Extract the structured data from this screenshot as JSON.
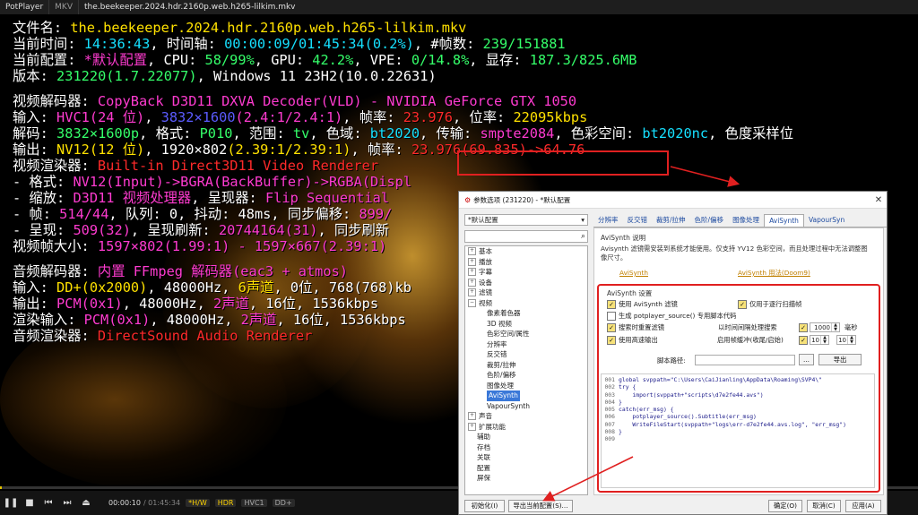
{
  "topbar": {
    "brand": "PotPlayer",
    "tabs": [
      "MKV",
      "the.beekeeper.2024.hdr.2160p.web.h265-lilkim.mkv"
    ]
  },
  "osd": {
    "file": {
      "label": "文件名:",
      "value": "the.beekeeper.2024.hdr.2160p.web.h265-lilkim.mkv"
    },
    "time": {
      "label": "当前时间:",
      "clock": "14:36:43",
      "timeline_label": "时间轴:",
      "timeline": "00:00:09/01:45:34",
      "pct": "(0.2%)",
      "frames_label": "#帧数:",
      "frames": "239/151881"
    },
    "config": {
      "label": "当前配置:",
      "profile": "*默认配置",
      "cpu_label": "CPU:",
      "cpu": "58/99%",
      "gpu_label": "GPU:",
      "gpu": "42.2%",
      "vpe_label": "VPE:",
      "vpe": "0/14.8%",
      "vram_label": "显存:",
      "vram": "187.3/825.6MB"
    },
    "version": {
      "label": "版本:",
      "value": "231220(1.7.22077)",
      "os": "Windows 11 23H2(10.0.22631)"
    },
    "vdec": {
      "label": "视频解码器:",
      "value": "CopyBack D3D11 DXVA Decoder(VLD) - NVIDIA GeForce GTX 1050"
    },
    "vin": {
      "label": "输入:",
      "codec": "HVC1(24 位)",
      "res": "3832×1600",
      "ar": "(2.4:1/2.4:1)",
      "fps_label": "帧率:",
      "fps": "23.976",
      "br_label": "位率:",
      "br": "22095kbps"
    },
    "vdecode": {
      "label": "解码:",
      "res": "3832×1600p",
      "fmt_label": "格式:",
      "fmt": "P010",
      "range_label": "范围:",
      "range": "tv",
      "prim_label": "色域:",
      "prim": "bt2020",
      "trc_label": "传输:",
      "trc": "smpte2084",
      "cs_label": "色彩空间:",
      "cs": "bt2020nc",
      "tail": "色度采样位"
    },
    "vout": {
      "label": "输出:",
      "fmt": "NV12(12 位)",
      "res": "1920×802",
      "ar": "(2.39:1/2.39:1)",
      "fps_label": "帧率:",
      "fps": "23.976(69.835)",
      "arrow": "->",
      "fps_out": "64.76"
    },
    "vren": {
      "label": "视频渲染器:",
      "value": "Built-in Direct3D11 Video Renderer"
    },
    "vren_fmt": {
      "label": " - 格式:",
      "value": "NV12(Input)->BGRA(BackBuffer)->RGBA(Displ"
    },
    "vren_scale": {
      "label": " - 缩放:",
      "value": "D3D11 视频处理器",
      "pres_label": "呈现器:",
      "pres": "Flip Sequential"
    },
    "vren_frame": {
      "label": " - 帧:",
      "value": "514/44",
      "q_label": "队列:",
      "q": "0",
      "jitter_label": "抖动:",
      "jitter": "48ms",
      "sync_label": "同步偏移:",
      "sync": "899/"
    },
    "vren_present": {
      "label": " - 呈现:",
      "value": "509(32)",
      "refresh_label": "呈现刷新:",
      "refresh": "20744164(31)",
      "sync_label": "同步刷新"
    },
    "vsize": {
      "label": "视频帧大小:",
      "value": "1597×802(1.99:1) - 1597×667(2.39:1)"
    },
    "adec": {
      "label": "音频解码器:",
      "value": "内置 FFmpeg 解码器(eac3 + atmos)"
    },
    "ain": {
      "label": "输入:",
      "codec": "DD+(0x2000)",
      "hz": "48000Hz",
      "ch": "6声道",
      "bits": "0位",
      "br": "768(768)kb"
    },
    "aout": {
      "label": "输出:",
      "codec": "PCM(0x1)",
      "hz": "48000Hz",
      "ch": "2声道",
      "bits": "16位",
      "br": "1536kbps"
    },
    "arin": {
      "label": "渲染输入:",
      "codec": "PCM(0x1)",
      "hz": "48000Hz",
      "ch": "2声道",
      "bits": "16位",
      "br": "1536kbps"
    },
    "aren": {
      "label": "音频渲染器:",
      "value": "DirectSound Audio Renderer"
    }
  },
  "controls": {
    "time_cur": "00:00:10",
    "time_total": "/ 01:45:34",
    "badges": [
      "*H/W",
      "HDR",
      "HVC1",
      "DD+"
    ],
    "progress": 0.002
  },
  "dialog": {
    "title": "参数选项 (231220) - *默认配置",
    "profile": "*默认配置",
    "tree": [
      {
        "label": "基本",
        "exp": "+",
        "level": 0
      },
      {
        "label": "播放",
        "exp": "+",
        "level": 0
      },
      {
        "label": "字幕",
        "exp": "+",
        "level": 0
      },
      {
        "label": "设备",
        "exp": "+",
        "level": 0
      },
      {
        "label": "滤镜",
        "exp": "+",
        "level": 0
      },
      {
        "label": "视频",
        "exp": "−",
        "level": 0
      },
      {
        "label": "像素着色器",
        "level": 1
      },
      {
        "label": "3D 视频",
        "level": 1
      },
      {
        "label": "色彩空间/属性",
        "level": 1
      },
      {
        "label": "分辨率",
        "level": 1
      },
      {
        "label": "反交错",
        "level": 1
      },
      {
        "label": "裁剪/拉伸",
        "level": 1
      },
      {
        "label": "色阶/偏移",
        "level": 1
      },
      {
        "label": "图像处理",
        "level": 1
      },
      {
        "label": "AviSynth",
        "level": 1,
        "selected": true
      },
      {
        "label": "VapourSynth",
        "level": 1
      },
      {
        "label": "声音",
        "exp": "+",
        "level": 0
      },
      {
        "label": "扩展功能",
        "exp": "+",
        "level": 0
      },
      {
        "label": "辅助",
        "level": 0
      },
      {
        "label": "存档",
        "level": 0
      },
      {
        "label": "关联",
        "level": 0
      },
      {
        "label": "配置",
        "level": 0
      },
      {
        "label": "屏保",
        "level": 0
      }
    ],
    "tabs": [
      "分辨率",
      "反交错",
      "裁剪/拉伸",
      "色阶/偏移",
      "图像处理",
      "AviSynth",
      "VapourSyn"
    ],
    "active_tab": "AviSynth",
    "about_title": "AviSynth 说明",
    "about_text": "Avisynth 滤镜需安装到系统才能使用。仅支持 YV12 色彩空间，而且处理过程中无法调整图像尺寸。",
    "link1": "AviSynth",
    "link2": "AviSynth 用法(Doom9)",
    "settings_title": "AviSynth 设置",
    "chk_use": "使用 AviSynth 滤镜",
    "chk_progressive": "仅用于逐行扫描帧",
    "chk_gen": "生成 potplayer_source() 专用脚本代码",
    "chk_reset": "搜索时重置滤镜",
    "chk_timed": "以时间间隔处理搜索",
    "timed_value": "1000",
    "timed_unit": "毫秒",
    "chk_fast": "使用高速输出",
    "chk_buffer": "启用帧缓冲(收尾/启始)",
    "buf1": "10",
    "buf2": "10",
    "path_label": "脚本路径:",
    "browse": "...",
    "export": "导出",
    "code": [
      {
        "n": "001",
        "t": "global svppath=\"C:\\Users\\CaiJianling\\AppData\\Roaming\\SVP4\\\""
      },
      {
        "n": "002",
        "t": "try {"
      },
      {
        "n": "003",
        "t": "    import(svppath+\"scripts\\d7e2fe44.avs\")"
      },
      {
        "n": "004",
        "t": "}"
      },
      {
        "n": "005",
        "t": "catch(err_msg) {"
      },
      {
        "n": "006",
        "t": "    potplayer_source().Subtitle(err_msg)"
      },
      {
        "n": "007",
        "t": "    WriteFileStart(svppath+\"logs\\err-d7e2fe44.avs.log\", \"err_msg\")"
      },
      {
        "n": "008",
        "t": "}"
      },
      {
        "n": "009",
        "t": ""
      }
    ],
    "btn_init": "初始化(I)",
    "btn_export": "导出当前配置(S)...",
    "btn_ok": "确定(O)",
    "btn_cancel": "取消(C)",
    "btn_apply": "应用(A)"
  }
}
